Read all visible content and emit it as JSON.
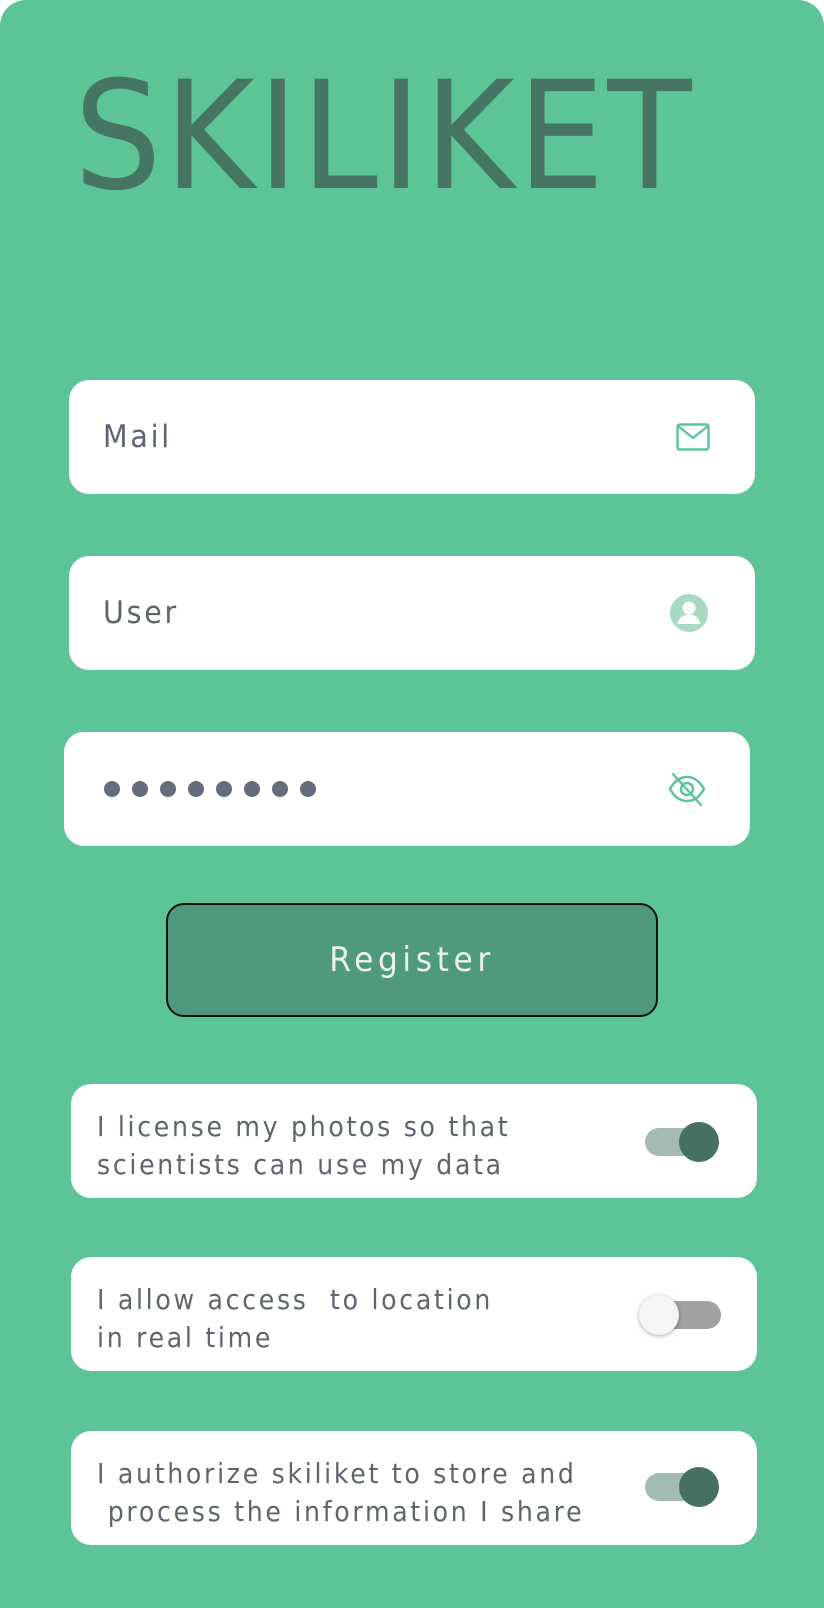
{
  "app": {
    "title": "SKILIKET"
  },
  "colors": {
    "background": "#5dc497",
    "logo": "#467563",
    "field_bg": "#ffffff",
    "field_text": "#5d6570",
    "icon_accent": "#5dc497",
    "button_bg": "#4f9a7c",
    "button_text": "#e9f2ee",
    "toggle_on_thumb": "#46705f",
    "toggle_on_track": "#a3bbb1",
    "toggle_off_thumb": "#f5f5f5",
    "toggle_off_track": "#a2a2a2"
  },
  "form": {
    "mail": {
      "placeholder": "Mail",
      "icon": "mail-icon"
    },
    "user": {
      "placeholder": "User",
      "icon": "user-icon"
    },
    "password": {
      "masked_value": "••••••••",
      "icon": "eye-off-icon"
    },
    "register_label": "Register"
  },
  "consents": [
    {
      "text": "I license my photos so that\nscientists can use my data",
      "enabled": true
    },
    {
      "text": "I allow access  to location\nin real time",
      "enabled": false
    },
    {
      "text": "I authorize skiliket to store and\n process the information I share",
      "enabled": true
    }
  ]
}
